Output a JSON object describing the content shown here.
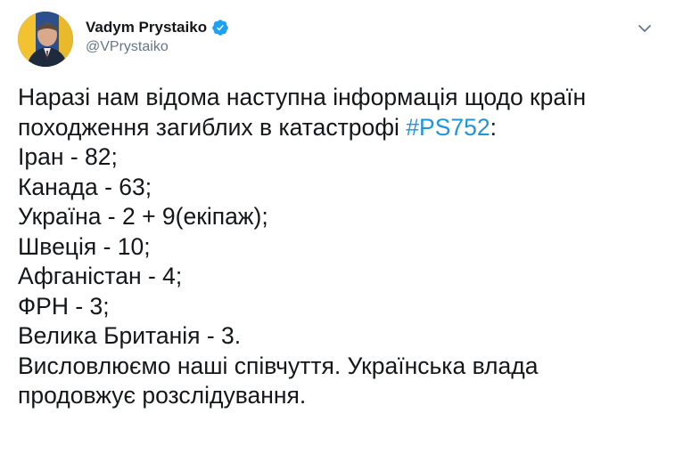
{
  "author": {
    "display_name": "Vadym Prystaiko",
    "handle": "@VPrystaiko",
    "verified": true
  },
  "icons": {
    "verified": "verified-badge-icon",
    "menu": "chevron-down-icon"
  },
  "colors": {
    "link": "#1b95e0",
    "verified_badge": "#1da1f2",
    "text": "#14171a",
    "secondary": "#657786"
  },
  "tweet": {
    "text_before_hashtag": "Наразі нам відома наступна інформація щодо країн походження загиблих в катастрофі ",
    "hashtag": "#PS752",
    "text_after_hashtag": ":\nІран - 82;\nКанада - 63;\nУкраїна - 2 + 9(екіпаж);\nШвеція - 10;\nАфганістан - 4;\nФРН - 3;\nВелика Британія - 3.\nВисловлюємо наші співчуття. Українська влада продовжує розслідування."
  }
}
